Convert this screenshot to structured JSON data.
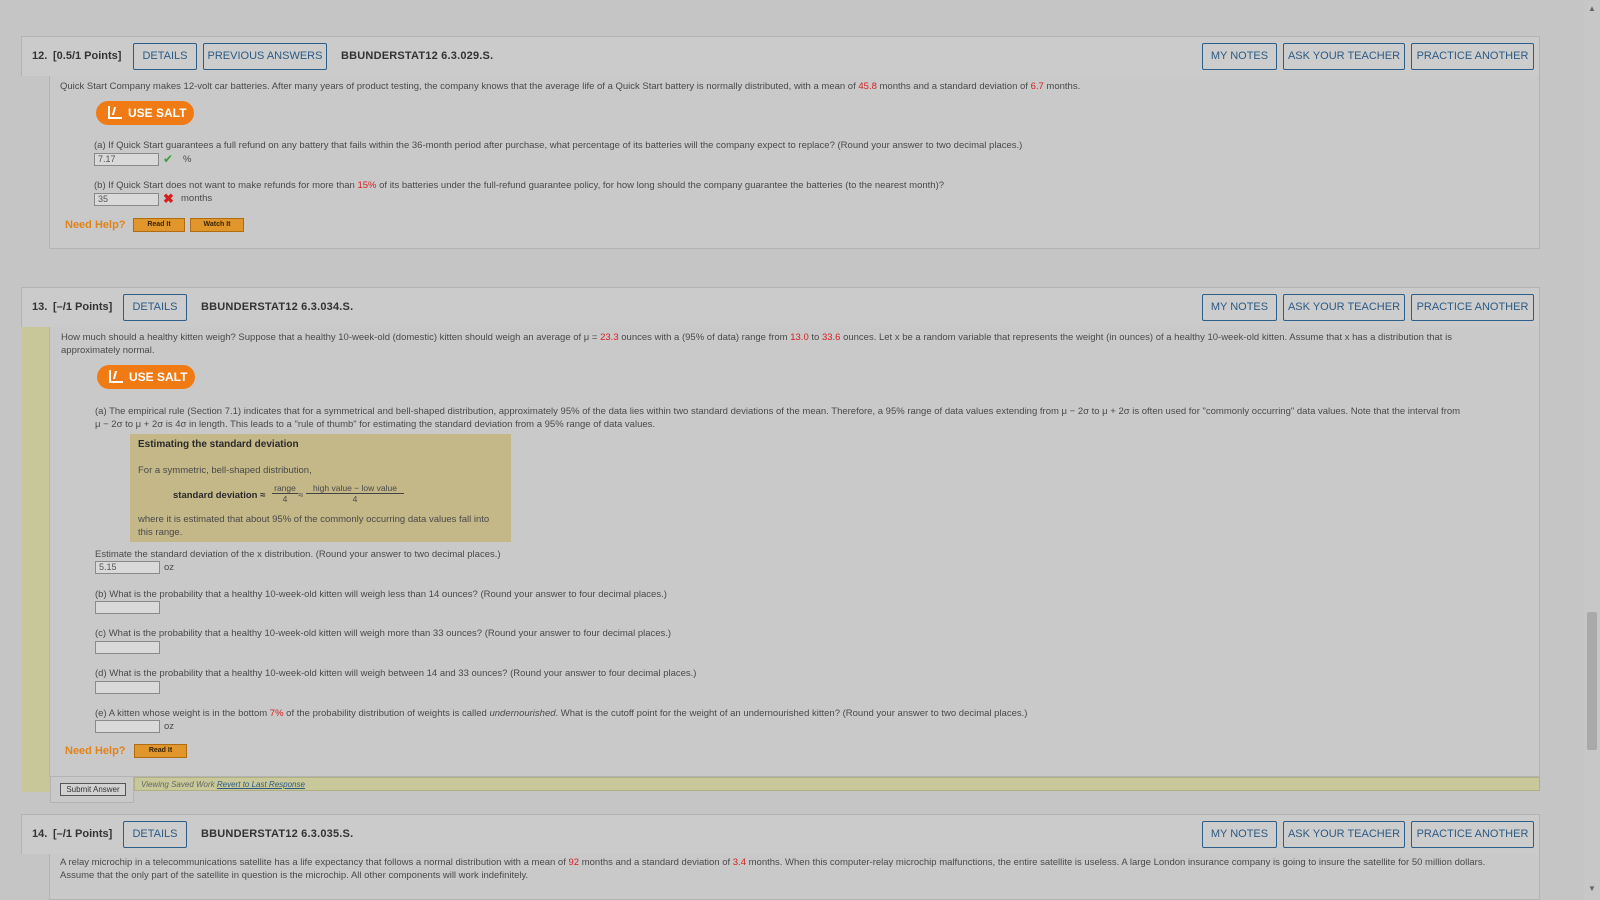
{
  "q12": {
    "number": "12.",
    "points": "[0.5/1 Points]",
    "details": "DETAILS",
    "prev_answers": "PREVIOUS ANSWERS",
    "code": "BBUNDERSTAT12 6.3.029.S.",
    "my_notes": "MY NOTES",
    "ask_teacher": "ASK YOUR TEACHER",
    "practice": "PRACTICE ANOTHER",
    "stem_1": "Quick Start Company makes 12-volt car batteries. After many years of product testing, the company knows that the average life of a Quick Start battery is normally distributed, with a mean of ",
    "mean": "45.8",
    "stem_2": " months and a standard deviation of ",
    "sd": "6.7",
    "stem_3": " months.",
    "use_salt": "USE SALT",
    "part_a": "(a) If Quick Start guarantees a full refund on any battery that fails within the 36-month period after purchase, what percentage of its batteries will the company expect to replace? (Round your answer to two decimal places.)",
    "answer_a": "7.17",
    "unit_a": "%",
    "part_b_1": "(b) If Quick Start does not want to make refunds for more than ",
    "part_b_pct": "15%",
    "part_b_2": " of its batteries under the full-refund guarantee policy, for how long should the company guarantee the batteries (to the nearest month)?",
    "answer_b": "35",
    "unit_b": "months",
    "need_help": "Need Help?",
    "read_it": "Read It",
    "watch_it": "Watch It"
  },
  "q13": {
    "number": "13.",
    "points": "[–/1 Points]",
    "details": "DETAILS",
    "code": "BBUNDERSTAT12 6.3.034.S.",
    "my_notes": "MY NOTES",
    "ask_teacher": "ASK YOUR TEACHER",
    "practice": "PRACTICE ANOTHER",
    "stem_1": "How much should a healthy kitten weigh? Suppose that a healthy 10-week-old (domestic) kitten should weigh an average of μ = ",
    "mu": "23.3",
    "stem_2": " ounces with a (95% of data) range from ",
    "low": "13.0",
    "stem_3": " to ",
    "high": "33.6",
    "stem_4": " ounces. Let x be a random variable that represents the weight (in ounces) of a healthy 10-week-old kitten. Assume that x has a distribution that is",
    "stem_5": "approximately normal.",
    "use_salt": "USE SALT",
    "part_a_1": "(a) The empirical rule (Section 7.1) indicates that for a symmetrical and bell-shaped distribution, approximately 95% of the data lies within two standard deviations of the mean. Therefore, a 95% range of data values extending from μ − 2σ to μ + 2σ is often used for \"commonly occurring\" data values. Note that the interval from",
    "part_a_2": "μ − 2σ to μ + 2σ is 4σ in length. This leads to a \"rule of thumb\" for estimating the standard deviation from a 95% range of data values.",
    "box_title": "Estimating the standard deviation",
    "box_line1": "For a symmetric, bell-shaped distribution,",
    "box_sd_label": "standard deviation ≈",
    "box_frac1_num": "range",
    "box_frac1_den": "4",
    "box_approx": "≈",
    "box_frac2_num": "high value − low value",
    "box_frac2_den": "4",
    "box_line3": "where it is estimated that about 95% of the commonly occurring data values fall into",
    "box_line4": "this range.",
    "estimate_q": "Estimate the standard deviation of the x distribution. (Round your answer to two decimal places.)",
    "answer_a": "5.15",
    "unit_oz": "oz",
    "part_b": "(b) What is the probability that a healthy 10-week-old kitten will weigh less than 14 ounces? (Round your answer to four decimal places.)",
    "part_c": "(c) What is the probability that a healthy 10-week-old kitten will weigh more than 33 ounces? (Round your answer to four decimal places.)",
    "part_d": "(d) What is the probability that a healthy 10-week-old kitten will weigh between 14 and 33 ounces? (Round your answer to four decimal places.)",
    "part_e_1": "(e) A kitten whose weight is in the bottom ",
    "part_e_pct": "7%",
    "part_e_2": " of the probability distribution of weights is called ",
    "part_e_italic": "undernourished",
    "part_e_3": ". What is the cutoff point for the weight of an undernourished kitten? (Round your answer to two decimal places.)",
    "need_help": "Need Help?",
    "read_it": "Read It",
    "submit": "Submit Answer",
    "viewing": "Viewing Saved Work",
    "revert": "Revert to Last Response"
  },
  "q14": {
    "number": "14.",
    "points": "[–/1 Points]",
    "details": "DETAILS",
    "code": "BBUNDERSTAT12 6.3.035.S.",
    "my_notes": "MY NOTES",
    "ask_teacher": "ASK YOUR TEACHER",
    "practice": "PRACTICE ANOTHER",
    "stem_1": "A relay microchip in a telecommunications satellite has a life expectancy that follows a normal distribution with a mean of ",
    "mean": "92",
    "stem_2": " months and a standard deviation of ",
    "sd": "3.4",
    "stem_3": " months. When this computer-relay microchip malfunctions, the entire satellite is useless. A large London insurance company is going to insure the satellite for 50 million dollars.",
    "stem_4": "Assume that the only part of the satellite in question is the microchip. All other components will work indefinitely."
  },
  "colors": {
    "background": "#c5c5c5",
    "button_text": "#2c5a85",
    "highlight_red": "#d61e1e",
    "salt_orange": "#f07a14",
    "help_orange": "#e1821a"
  }
}
